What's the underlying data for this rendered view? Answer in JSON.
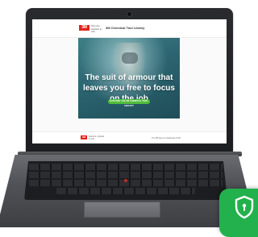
{
  "site": {
    "brand_logo": "3M",
    "brand_tagline": "Science. Applied to Life.",
    "title": "3M Chemical Tool Library"
  },
  "hero": {
    "headline": "The suit of armour that leaves you free to focus on the job",
    "cta_label": "EXPLORE THE 3M CHEMICAL TOOL LIBRARY"
  },
  "footer": {
    "logo": "3M",
    "tagline": "Science. Applied to Life.",
    "note": "The 3M logo is a trademark of 3M"
  },
  "colors": {
    "brand_red": "#e2231a",
    "hero_teal": "#2b6470",
    "cta_green": "#4fbe3c",
    "badge_green": "#22b14c"
  },
  "icons": {
    "badge": "shield-icon"
  }
}
